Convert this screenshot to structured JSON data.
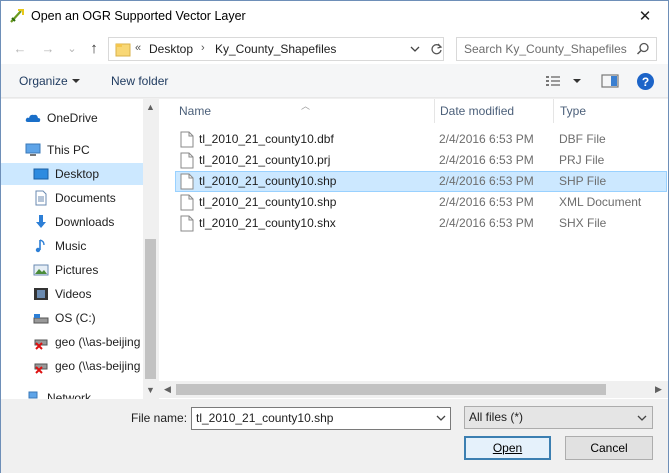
{
  "window": {
    "title": "Open an OGR Supported Vector Layer",
    "close_glyph": "✕"
  },
  "nav": {
    "back_glyph": "←",
    "forward_glyph": "→",
    "recent_glyph": "⌄",
    "up_glyph": "↑",
    "breadcrumb_overflow": "«",
    "breadcrumb": [
      "Desktop",
      "Ky_County_Shapefiles"
    ],
    "search_placeholder": "Search Ky_County_Shapefiles"
  },
  "toolbar": {
    "organize_label": "Organize",
    "new_folder_label": "New folder",
    "help_glyph": "?"
  },
  "sidebar": {
    "items": [
      {
        "label": "OneDrive",
        "icon": "cloud-icon"
      },
      {
        "label": "This PC",
        "icon": "computer-icon"
      },
      {
        "label": "Desktop",
        "icon": "desktop-icon"
      },
      {
        "label": "Documents",
        "icon": "documents-icon"
      },
      {
        "label": "Downloads",
        "icon": "downloads-icon"
      },
      {
        "label": "Music",
        "icon": "music-icon"
      },
      {
        "label": "Pictures",
        "icon": "pictures-icon"
      },
      {
        "label": "Videos",
        "icon": "videos-icon"
      },
      {
        "label": "OS (C:)",
        "icon": "drive-icon"
      },
      {
        "label": "geo (\\\\as-beijing",
        "icon": "network-drive-icon"
      },
      {
        "label": "geo (\\\\as-beijing",
        "icon": "network-drive-icon"
      },
      {
        "label": "Network",
        "icon": "network-icon"
      }
    ],
    "selected_index": 2
  },
  "filelist": {
    "columns": [
      "Name",
      "Date modified",
      "Type"
    ],
    "rows": [
      {
        "name": "tl_2010_21_county10.dbf",
        "date": "2/4/2016 6:53 PM",
        "type": "DBF File"
      },
      {
        "name": "tl_2010_21_county10.prj",
        "date": "2/4/2016 6:53 PM",
        "type": "PRJ File"
      },
      {
        "name": "tl_2010_21_county10.shp",
        "date": "2/4/2016 6:53 PM",
        "type": "SHP File"
      },
      {
        "name": "tl_2010_21_county10.shp",
        "date": "2/4/2016 6:53 PM",
        "type": "XML Document"
      },
      {
        "name": "tl_2010_21_county10.shx",
        "date": "2/4/2016 6:53 PM",
        "type": "SHX File"
      }
    ],
    "selected_index": 2
  },
  "bottom": {
    "filename_label": "File name:",
    "filename_value": "tl_2010_21_county10.shp",
    "filter_value": "All files (*)",
    "open_label": "Open",
    "cancel_label": "Cancel"
  },
  "colors": {
    "selection": "#cce8ff",
    "accent": "#1c64c8"
  }
}
